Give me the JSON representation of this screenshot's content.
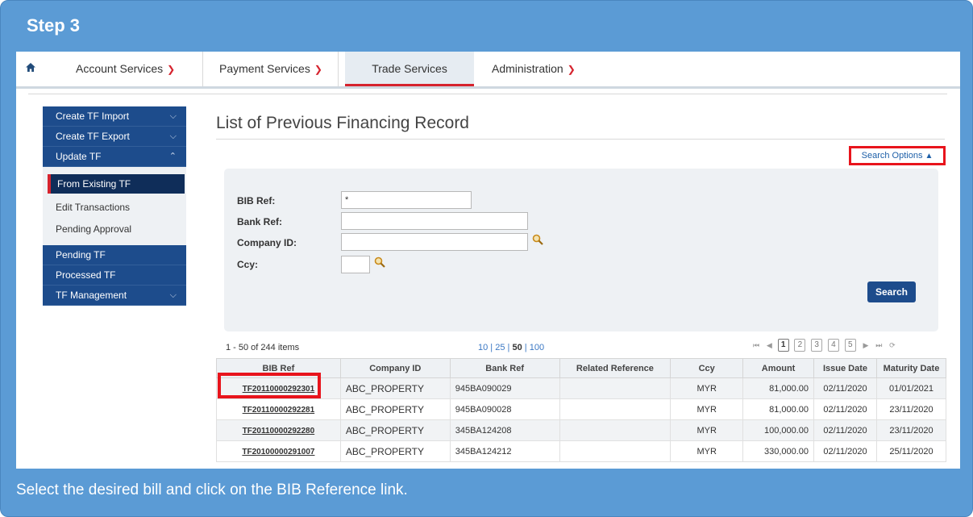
{
  "step_title": "Step 3",
  "instruction": "Select the desired bill and click on the BIB Reference link.",
  "topnav": {
    "items": [
      {
        "label": "Account Services"
      },
      {
        "label": "Payment Services"
      },
      {
        "label": "Trade Services"
      },
      {
        "label": "Administration"
      }
    ]
  },
  "sidebar": {
    "create_import": "Create TF Import",
    "create_export": "Create TF Export",
    "update": "Update TF",
    "sub_selected": "From Existing TF",
    "sub_edit": "Edit Transactions",
    "sub_pending": "Pending Approval",
    "pending": "Pending TF",
    "processed": "Processed TF",
    "management": "TF Management"
  },
  "main": {
    "title": "List of Previous Financing Record",
    "search_options": "Search Options"
  },
  "search": {
    "bib_ref_label": "BIB Ref:",
    "bib_ref_value": "*",
    "bank_ref_label": "Bank Ref:",
    "company_id_label": "Company ID:",
    "ccy_label": "Ccy:",
    "button": "Search"
  },
  "grid": {
    "info": "1 - 50 of 244 items",
    "size_10": "10",
    "size_25": "25",
    "size_50": "50",
    "size_100": "100",
    "pages": [
      "1",
      "2",
      "3",
      "4",
      "5"
    ],
    "columns": [
      "BIB Ref",
      "Company ID",
      "Bank Ref",
      "Related Reference",
      "Ccy",
      "Amount",
      "Issue Date",
      "Maturity Date"
    ],
    "rows": [
      {
        "bib": "TF20110000292301",
        "company": "ABC_PROPERTY",
        "bank": "945BA090029",
        "related": "",
        "ccy": "MYR",
        "amount": "81,000.00",
        "issue": "02/11/2020",
        "maturity": "01/01/2021"
      },
      {
        "bib": "TF20110000292281",
        "company": "ABC_PROPERTY",
        "bank": "945BA090028",
        "related": "",
        "ccy": "MYR",
        "amount": "81,000.00",
        "issue": "02/11/2020",
        "maturity": "23/11/2020"
      },
      {
        "bib": "TF20110000292280",
        "company": "ABC_PROPERTY",
        "bank": "345BA124208",
        "related": "",
        "ccy": "MYR",
        "amount": "100,000.00",
        "issue": "02/11/2020",
        "maturity": "23/11/2020"
      },
      {
        "bib": "TF20100000291007",
        "company": "ABC_PROPERTY",
        "bank": "345BA124212",
        "related": "",
        "ccy": "MYR",
        "amount": "330,000.00",
        "issue": "02/11/2020",
        "maturity": "25/11/2020"
      }
    ]
  },
  "colors": {
    "frame": "#5b9bd5",
    "nav_dark": "#1d4c8c",
    "highlight": "#e8141c",
    "accent_red": "#d6232e"
  }
}
